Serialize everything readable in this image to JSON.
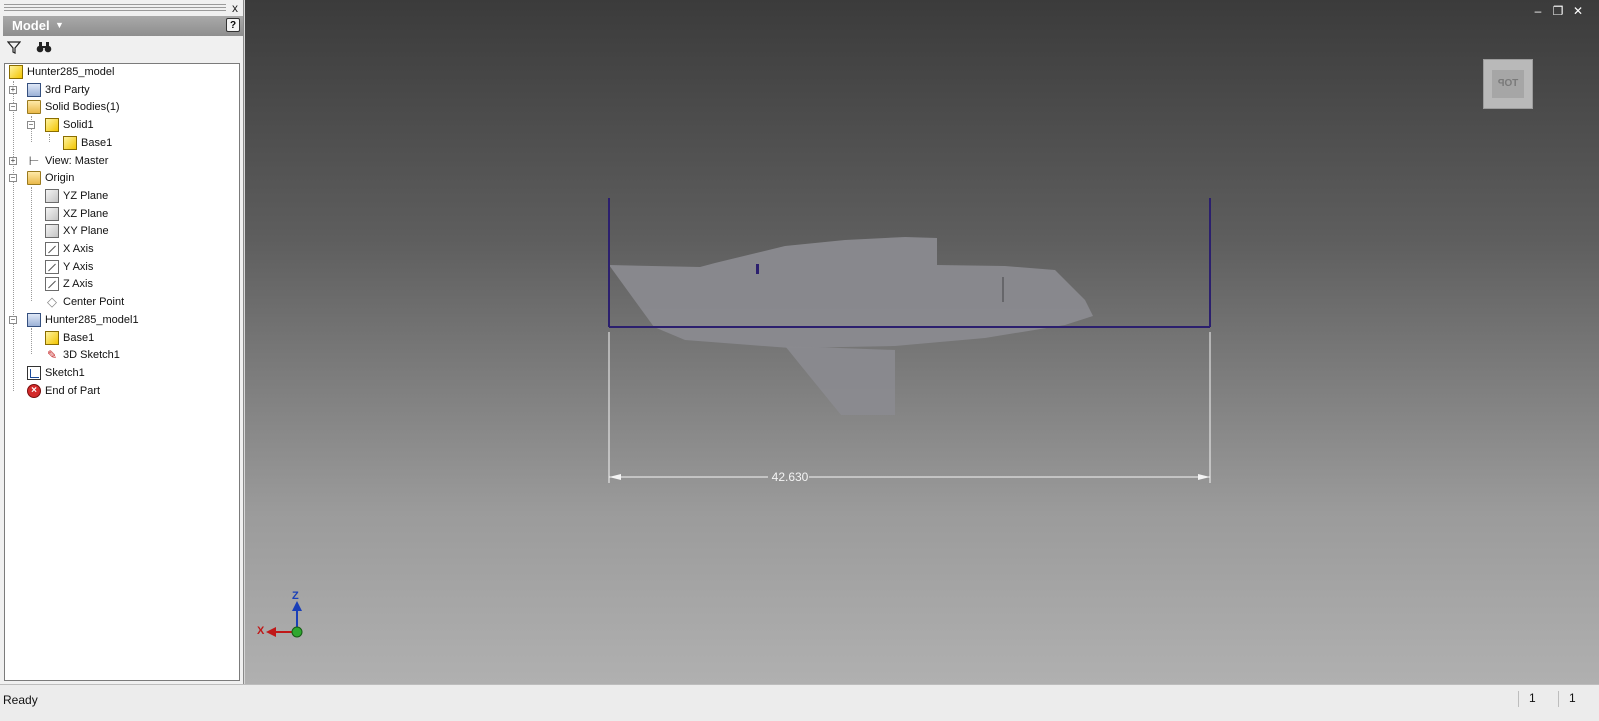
{
  "browser": {
    "title": "Model",
    "help_label": "?",
    "close_label": "x",
    "tree": [
      {
        "label": "Hunter285_model",
        "icon": "part-icon"
      },
      {
        "label": "3rd Party",
        "icon": "third-party-icon"
      },
      {
        "label": "Solid Bodies(1)",
        "icon": "solid-bodies-folder-icon"
      },
      {
        "label": "Solid1",
        "icon": "solid-body-icon"
      },
      {
        "label": "Base1",
        "icon": "base-feature-icon"
      },
      {
        "label": "View: Master",
        "icon": "view-rep-icon"
      },
      {
        "label": "Origin",
        "icon": "folder-open-icon"
      },
      {
        "label": "YZ Plane",
        "icon": "plane-icon"
      },
      {
        "label": "XZ Plane",
        "icon": "plane-icon"
      },
      {
        "label": "XY Plane",
        "icon": "plane-icon"
      },
      {
        "label": "X Axis",
        "icon": "axis-icon"
      },
      {
        "label": "Y Axis",
        "icon": "axis-icon"
      },
      {
        "label": "Z Axis",
        "icon": "axis-icon"
      },
      {
        "label": "Center Point",
        "icon": "center-point-icon"
      },
      {
        "label": "Hunter285_model1",
        "icon": "derived-part-icon"
      },
      {
        "label": "Base1",
        "icon": "base-feature-icon"
      },
      {
        "label": "3D Sketch1",
        "icon": "3d-sketch-icon"
      },
      {
        "label": "Sketch1",
        "icon": "sketch-icon"
      },
      {
        "label": "End of Part",
        "icon": "end-of-part-icon"
      }
    ]
  },
  "viewport": {
    "dimension_value": "42.630",
    "viewcube_label": "TOP",
    "axis_labels": {
      "z": "Z",
      "x": "X"
    },
    "colors": {
      "sketch_line": "#2b1f6e",
      "hull": "#8a8a8f",
      "dimension": "#f4f4f4",
      "x_axis": "#c01818",
      "z_axis": "#1a3fb8",
      "origin": "#2fa82f"
    }
  },
  "status": {
    "text": "Ready",
    "cell1": "1",
    "cell2": "1"
  }
}
